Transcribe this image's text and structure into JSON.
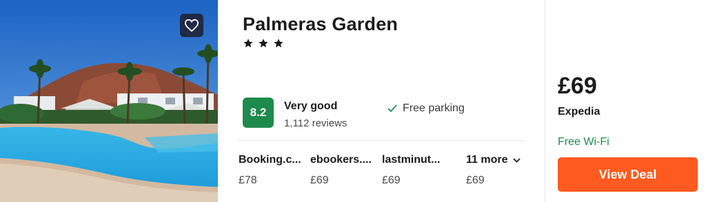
{
  "hotel": {
    "name": "Palmeras Garden",
    "stars": 3,
    "score": "8.2",
    "rating_label": "Very good",
    "review_count": "1,112 reviews",
    "amenity": "Free parking"
  },
  "providers": [
    {
      "name": "Booking.c...",
      "price": "£78"
    },
    {
      "name": "ebookers....",
      "price": "£69"
    },
    {
      "name": "lastminut...",
      "price": "£69"
    },
    {
      "name": "11 more",
      "price": "£69"
    }
  ],
  "deal": {
    "price": "£69",
    "provider": "Expedia",
    "amenity": "Free Wi-Fi",
    "button_label": "View Deal"
  },
  "icons": {
    "favorite": "heart-icon",
    "star": "star-icon",
    "check": "check-icon",
    "chevron": "chevron-down-icon"
  },
  "colors": {
    "score_badge": "#1e8a4c",
    "amenity_green": "#1e8a4c",
    "deal_button": "#ff5a1f",
    "favorite_button": "#1f2a44"
  }
}
